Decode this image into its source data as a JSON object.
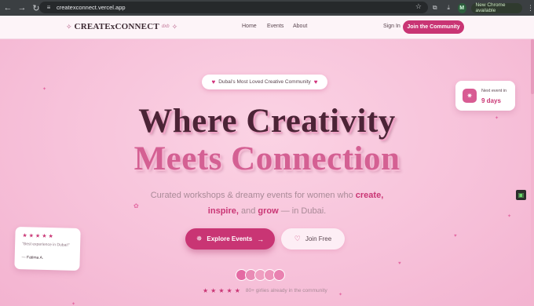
{
  "browser": {
    "back_icon": "arrow-left-icon",
    "url": "createxconnect.vercel.app",
    "update_label": "New Chrome available",
    "profile_initial": "M"
  },
  "header": {
    "logo_name": "CREATExCONNECT",
    "logo_suffix": "dxb",
    "nav": [
      "Home",
      "Events",
      "About"
    ],
    "signin_label": "Sign In",
    "cta_label": "Join the Community"
  },
  "hero": {
    "badge_text": "Dubai's Most Loved Creative Community",
    "title_line1": "Where Creativity",
    "title_line2": "Meets Connection",
    "subtitle_pre": "Curated workshops & dreamy events for women who ",
    "subtitle_create": "create,",
    "subtitle_inspire": "inspire,",
    "subtitle_mid": " and ",
    "subtitle_grow": "grow",
    "subtitle_post": " — in Dubai.",
    "explore_label": "Explore Events",
    "join_free_label": "Join Free",
    "social_text": "80+ girlies already in the community",
    "avatar_colors": [
      "#e46aa3",
      "#e98bb5",
      "#ef9fc1",
      "#ed94ba",
      "#e981b0"
    ]
  },
  "next_event": {
    "label": "Next event in",
    "value": "9 days"
  },
  "review": {
    "quote": "\"Best experience in Dubai!\"",
    "author": "— Fatima A."
  },
  "colors": {
    "accent": "#c93574",
    "title_dark": "#4b2436",
    "title_pink": "#d46093"
  }
}
